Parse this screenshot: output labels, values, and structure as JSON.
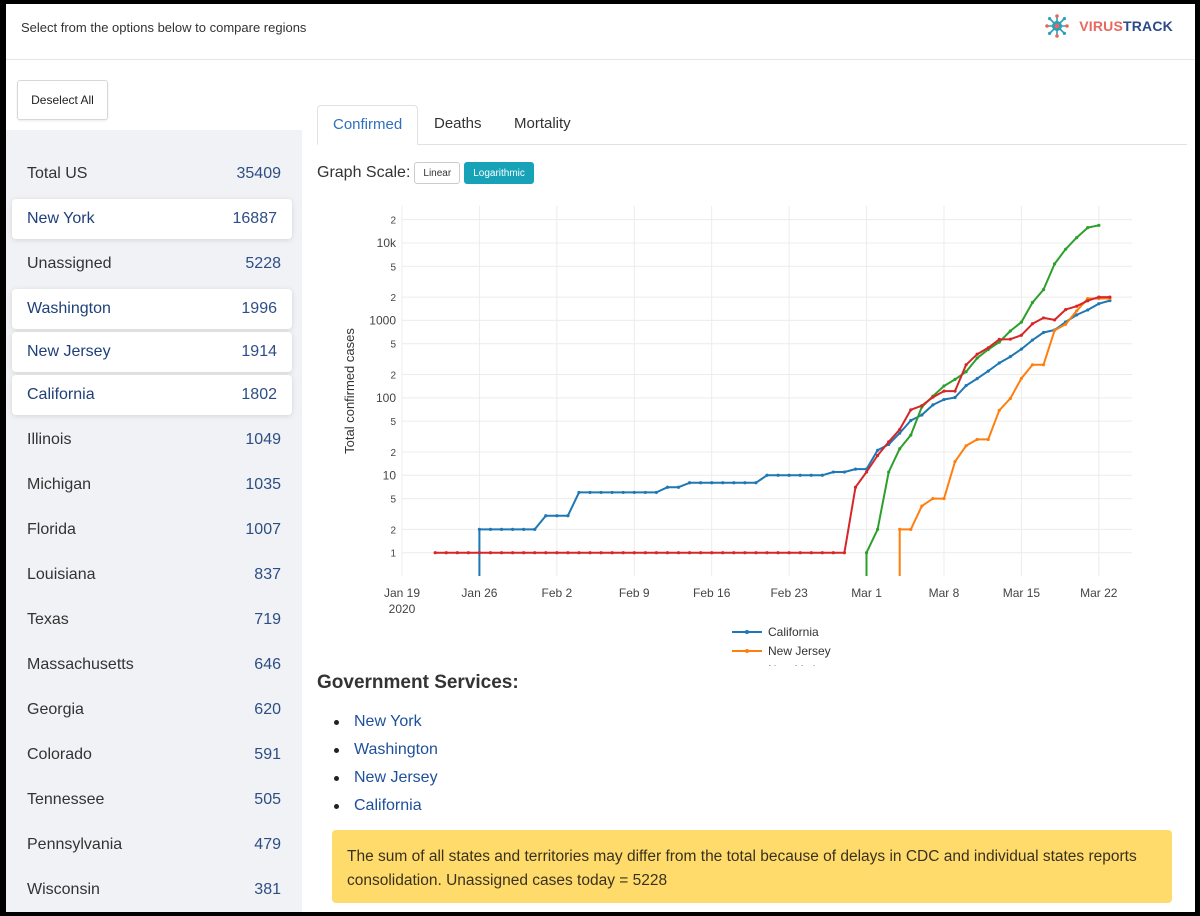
{
  "header": {
    "instruction": "Select from the options below to compare regions",
    "logo_v": "VIRUS",
    "logo_t": "TRACK"
  },
  "sidebar": {
    "deselect_label": "Deselect All",
    "items": [
      {
        "name": "Total US",
        "value": "35409",
        "selected": false
      },
      {
        "name": "New York",
        "value": "16887",
        "selected": true
      },
      {
        "name": "Unassigned",
        "value": "5228",
        "selected": false
      },
      {
        "name": "Washington",
        "value": "1996",
        "selected": true
      },
      {
        "name": "New Jersey",
        "value": "1914",
        "selected": true
      },
      {
        "name": "California",
        "value": "1802",
        "selected": true
      },
      {
        "name": "Illinois",
        "value": "1049",
        "selected": false
      },
      {
        "name": "Michigan",
        "value": "1035",
        "selected": false
      },
      {
        "name": "Florida",
        "value": "1007",
        "selected": false
      },
      {
        "name": "Louisiana",
        "value": "837",
        "selected": false
      },
      {
        "name": "Texas",
        "value": "719",
        "selected": false
      },
      {
        "name": "Massachusetts",
        "value": "646",
        "selected": false
      },
      {
        "name": "Georgia",
        "value": "620",
        "selected": false
      },
      {
        "name": "Colorado",
        "value": "591",
        "selected": false
      },
      {
        "name": "Tennessee",
        "value": "505",
        "selected": false
      },
      {
        "name": "Pennsylvania",
        "value": "479",
        "selected": false
      },
      {
        "name": "Wisconsin",
        "value": "381",
        "selected": false
      }
    ]
  },
  "tabs": [
    "Confirmed",
    "Deaths",
    "Mortality"
  ],
  "active_tab": "Confirmed",
  "scale": {
    "label": "Graph Scale:",
    "linear": "Linear",
    "log": "Logarithmic",
    "active": "Logarithmic"
  },
  "gov": {
    "title": "Government Services:",
    "links": [
      "New York",
      "Washington",
      "New Jersey",
      "California"
    ]
  },
  "alert_text": "The sum of all states and territories may differ from the total because of delays in CDC and individual states reports consolidation. Unassigned cases today = 5228",
  "colors": {
    "accent": "#2f6fbf",
    "alert": "#fedb6a",
    "logarithmic_button": "#17a2b8"
  },
  "chart_data": {
    "type": "line",
    "ylabel": "Total confirmed cases",
    "yscale": "log",
    "ylim": [
      0.5,
      30000
    ],
    "xlim": [
      "2020-01-19",
      "2020-03-25"
    ],
    "xticks": [
      "Jan 19",
      "Jan 26",
      "Feb 2",
      "Feb 9",
      "Feb 16",
      "Feb 23",
      "Mar 1",
      "Mar 8",
      "Mar 15",
      "Mar 22"
    ],
    "xtick_sub": "2020",
    "yticks": [
      {
        "v": 1,
        "label": "1"
      },
      {
        "v": 2,
        "label": "2"
      },
      {
        "v": 5,
        "label": "5"
      },
      {
        "v": 10,
        "label": "10"
      },
      {
        "v": 20,
        "label": "2"
      },
      {
        "v": 50,
        "label": "5"
      },
      {
        "v": 100,
        "label": "100"
      },
      {
        "v": 200,
        "label": "2"
      },
      {
        "v": 500,
        "label": "5"
      },
      {
        "v": 1000,
        "label": "1000"
      },
      {
        "v": 2000,
        "label": "2"
      },
      {
        "v": 5000,
        "label": "5"
      },
      {
        "v": 10000,
        "label": "10k"
      },
      {
        "v": 20000,
        "label": "2"
      }
    ],
    "grid": true,
    "legend_position": "bottom-center",
    "series": [
      {
        "name": "California",
        "color": "#1f77b4",
        "points": [
          [
            "2020-01-26",
            0.5
          ],
          [
            "2020-01-26",
            2
          ],
          [
            "2020-01-27",
            2
          ],
          [
            "2020-01-28",
            2
          ],
          [
            "2020-01-29",
            2
          ],
          [
            "2020-01-30",
            2
          ],
          [
            "2020-01-31",
            2
          ],
          [
            "2020-02-01",
            3
          ],
          [
            "2020-02-02",
            3
          ],
          [
            "2020-02-03",
            3
          ],
          [
            "2020-02-04",
            6
          ],
          [
            "2020-02-05",
            6
          ],
          [
            "2020-02-06",
            6
          ],
          [
            "2020-02-07",
            6
          ],
          [
            "2020-02-08",
            6
          ],
          [
            "2020-02-09",
            6
          ],
          [
            "2020-02-10",
            6
          ],
          [
            "2020-02-11",
            6
          ],
          [
            "2020-02-12",
            7
          ],
          [
            "2020-02-13",
            7
          ],
          [
            "2020-02-14",
            8
          ],
          [
            "2020-02-15",
            8
          ],
          [
            "2020-02-16",
            8
          ],
          [
            "2020-02-17",
            8
          ],
          [
            "2020-02-18",
            8
          ],
          [
            "2020-02-19",
            8
          ],
          [
            "2020-02-20",
            8
          ],
          [
            "2020-02-21",
            10
          ],
          [
            "2020-02-22",
            10
          ],
          [
            "2020-02-23",
            10
          ],
          [
            "2020-02-24",
            10
          ],
          [
            "2020-02-25",
            10
          ],
          [
            "2020-02-26",
            10
          ],
          [
            "2020-02-27",
            11
          ],
          [
            "2020-02-28",
            11
          ],
          [
            "2020-02-29",
            12
          ],
          [
            "2020-03-01",
            12
          ],
          [
            "2020-03-02",
            21
          ],
          [
            "2020-03-03",
            25
          ],
          [
            "2020-03-04",
            35
          ],
          [
            "2020-03-05",
            51
          ],
          [
            "2020-03-06",
            60
          ],
          [
            "2020-03-07",
            81
          ],
          [
            "2020-03-08",
            95
          ],
          [
            "2020-03-09",
            101
          ],
          [
            "2020-03-10",
            144
          ],
          [
            "2020-03-11",
            177
          ],
          [
            "2020-03-12",
            221
          ],
          [
            "2020-03-13",
            282
          ],
          [
            "2020-03-14",
            340
          ],
          [
            "2020-03-15",
            426
          ],
          [
            "2020-03-16",
            557
          ],
          [
            "2020-03-17",
            698
          ],
          [
            "2020-03-18",
            751
          ],
          [
            "2020-03-19",
            952
          ],
          [
            "2020-03-20",
            1177
          ],
          [
            "2020-03-21",
            1364
          ],
          [
            "2020-03-22",
            1642
          ],
          [
            "2020-03-23",
            1802
          ]
        ]
      },
      {
        "name": "New Jersey",
        "color": "#ff7f0e",
        "points": [
          [
            "2020-03-04",
            0.5
          ],
          [
            "2020-03-04",
            2
          ],
          [
            "2020-03-05",
            2
          ],
          [
            "2020-03-06",
            4
          ],
          [
            "2020-03-07",
            5
          ],
          [
            "2020-03-08",
            5
          ],
          [
            "2020-03-09",
            15
          ],
          [
            "2020-03-10",
            24
          ],
          [
            "2020-03-11",
            29
          ],
          [
            "2020-03-12",
            29
          ],
          [
            "2020-03-13",
            69
          ],
          [
            "2020-03-14",
            98
          ],
          [
            "2020-03-15",
            178
          ],
          [
            "2020-03-16",
            267
          ],
          [
            "2020-03-17",
            267
          ],
          [
            "2020-03-18",
            742
          ],
          [
            "2020-03-19",
            890
          ],
          [
            "2020-03-20",
            1327
          ],
          [
            "2020-03-21",
            1914
          ],
          [
            "2020-03-22",
            1914
          ],
          [
            "2020-03-23",
            1914
          ]
        ]
      },
      {
        "name": "New York",
        "color": "#2ca02c",
        "points": [
          [
            "2020-03-01",
            0.5
          ],
          [
            "2020-03-01",
            1
          ],
          [
            "2020-03-02",
            2
          ],
          [
            "2020-03-03",
            11
          ],
          [
            "2020-03-04",
            22
          ],
          [
            "2020-03-05",
            33
          ],
          [
            "2020-03-06",
            76
          ],
          [
            "2020-03-07",
            105
          ],
          [
            "2020-03-08",
            142
          ],
          [
            "2020-03-09",
            173
          ],
          [
            "2020-03-10",
            217
          ],
          [
            "2020-03-11",
            326
          ],
          [
            "2020-03-12",
            421
          ],
          [
            "2020-03-13",
            524
          ],
          [
            "2020-03-14",
            729
          ],
          [
            "2020-03-15",
            950
          ],
          [
            "2020-03-16",
            1700
          ],
          [
            "2020-03-17",
            2495
          ],
          [
            "2020-03-18",
            5365
          ],
          [
            "2020-03-19",
            8310
          ],
          [
            "2020-03-20",
            11710
          ],
          [
            "2020-03-21",
            15800
          ],
          [
            "2020-03-22",
            16887
          ]
        ]
      },
      {
        "name": "Washington",
        "color": "#d62728",
        "points": [
          [
            "2020-01-22",
            1
          ],
          [
            "2020-01-23",
            1
          ],
          [
            "2020-01-24",
            1
          ],
          [
            "2020-01-25",
            1
          ],
          [
            "2020-01-26",
            1
          ],
          [
            "2020-01-27",
            1
          ],
          [
            "2020-01-28",
            1
          ],
          [
            "2020-01-29",
            1
          ],
          [
            "2020-01-30",
            1
          ],
          [
            "2020-01-31",
            1
          ],
          [
            "2020-02-01",
            1
          ],
          [
            "2020-02-02",
            1
          ],
          [
            "2020-02-03",
            1
          ],
          [
            "2020-02-04",
            1
          ],
          [
            "2020-02-05",
            1
          ],
          [
            "2020-02-06",
            1
          ],
          [
            "2020-02-07",
            1
          ],
          [
            "2020-02-08",
            1
          ],
          [
            "2020-02-09",
            1
          ],
          [
            "2020-02-10",
            1
          ],
          [
            "2020-02-11",
            1
          ],
          [
            "2020-02-12",
            1
          ],
          [
            "2020-02-13",
            1
          ],
          [
            "2020-02-14",
            1
          ],
          [
            "2020-02-15",
            1
          ],
          [
            "2020-02-16",
            1
          ],
          [
            "2020-02-17",
            1
          ],
          [
            "2020-02-18",
            1
          ],
          [
            "2020-02-19",
            1
          ],
          [
            "2020-02-20",
            1
          ],
          [
            "2020-02-21",
            1
          ],
          [
            "2020-02-22",
            1
          ],
          [
            "2020-02-23",
            1
          ],
          [
            "2020-02-24",
            1
          ],
          [
            "2020-02-25",
            1
          ],
          [
            "2020-02-26",
            1
          ],
          [
            "2020-02-27",
            1
          ],
          [
            "2020-02-28",
            1
          ],
          [
            "2020-02-29",
            7
          ],
          [
            "2020-03-01",
            11
          ],
          [
            "2020-03-02",
            18
          ],
          [
            "2020-03-03",
            27
          ],
          [
            "2020-03-04",
            39
          ],
          [
            "2020-03-05",
            70
          ],
          [
            "2020-03-06",
            79
          ],
          [
            "2020-03-07",
            102
          ],
          [
            "2020-03-08",
            122
          ],
          [
            "2020-03-09",
            122
          ],
          [
            "2020-03-10",
            267
          ],
          [
            "2020-03-11",
            366
          ],
          [
            "2020-03-12",
            442
          ],
          [
            "2020-03-13",
            568
          ],
          [
            "2020-03-14",
            572
          ],
          [
            "2020-03-15",
            643
          ],
          [
            "2020-03-16",
            904
          ],
          [
            "2020-03-17",
            1076
          ],
          [
            "2020-03-18",
            1014
          ],
          [
            "2020-03-19",
            1376
          ],
          [
            "2020-03-20",
            1524
          ],
          [
            "2020-03-21",
            1793
          ],
          [
            "2020-03-22",
            1996
          ],
          [
            "2020-03-23",
            1996
          ]
        ]
      }
    ]
  }
}
